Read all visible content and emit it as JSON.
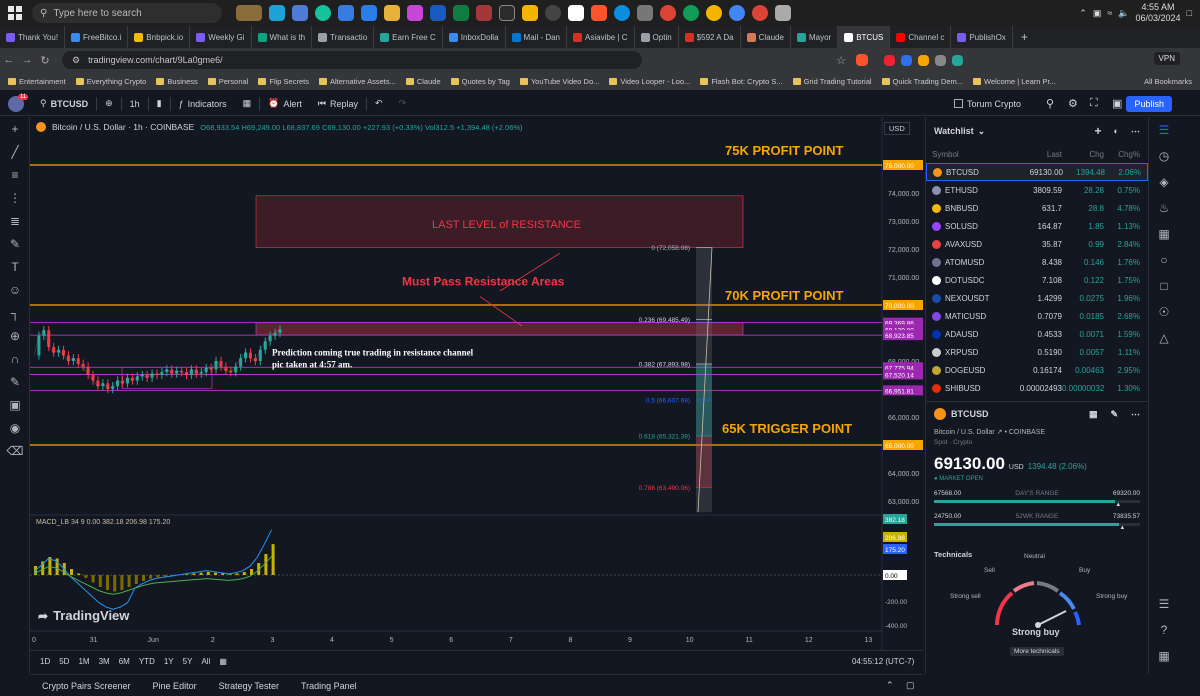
{
  "taskbar": {
    "search_placeholder": "Type here to search",
    "time": "4:55 AM",
    "date": "06/03/2024"
  },
  "tabs": [
    {
      "label": "Thank You!",
      "color": "#7a5cf0"
    },
    {
      "label": "FreeBitco.i",
      "color": "#3a8cf5"
    },
    {
      "label": "Bnbpick.io",
      "color": "#f0b90b"
    },
    {
      "label": "Weekly Gi",
      "color": "#7a5cf0"
    },
    {
      "label": "What is th",
      "color": "#10a37f"
    },
    {
      "label": "Transactio",
      "color": "#9aa0a6"
    },
    {
      "label": "Earn Free C",
      "color": "#26a69a"
    },
    {
      "label": "InboxDolla",
      "color": "#3a8cf5"
    },
    {
      "label": "Mail - Dan",
      "color": "#0078d4"
    },
    {
      "label": "Asiavibe | C",
      "color": "#d93025"
    },
    {
      "label": "Optin",
      "color": "#9aa0a6"
    },
    {
      "label": "$592 A Da",
      "color": "#d93025"
    },
    {
      "label": "Claude",
      "color": "#d97757"
    },
    {
      "label": "Mayor",
      "color": "#26a69a"
    },
    {
      "label": "BTCUS",
      "color": "#ffffff",
      "active": true
    },
    {
      "label": "Channel c",
      "color": "#ff0000"
    },
    {
      "label": "PublishOx",
      "color": "#7a5cf0"
    }
  ],
  "address": {
    "url": "tradingview.com/chart/9La0gme6/",
    "vpn": "VPN"
  },
  "bookmarks": [
    "Entertainment",
    "Everything Crypto",
    "Business",
    "Personal",
    "Flip Secrets",
    "Alternative Assets...",
    "Claude",
    "Quotes by Tag",
    "YouTube Video Do...",
    "Video Looper - Loo...",
    "Flash Bot: Crypto S...",
    "Grid Trading Tutorial",
    "Quick Trading Dem...",
    "Welcome | Learn Pr..."
  ],
  "bookmarks_all": "All Bookmarks",
  "toolbar": {
    "badge": "11",
    "symbol": "BTCUSD",
    "interval": "1h",
    "indicators": "Indicators",
    "alert": "Alert",
    "replay": "Replay",
    "layout_name": "Torum Crypto",
    "publish": "Publish"
  },
  "chart": {
    "title": "Bitcoin / U.S. Dollar · 1h · COINBASE",
    "ohlc": "O68,933.54 H69,249.00 L68,837.69 C69,130.00 +227.93 (+0.33%) Vol312.5 +1,394.48 (+2.06%)",
    "currency": "USD",
    "annotations": {
      "p75": "75K PROFIT POINT",
      "p70": "70K PROFIT POINT",
      "p65": "65K TRIGGER POINT",
      "resistance": "LAST LEVEL of RESISTANCE",
      "must_pass": "Must Pass Resistance Areas",
      "prediction_line1": "Prediction coming true trading in resistance channel",
      "prediction_line2": "pic taken at 4:57 am."
    },
    "fib_labels": [
      "0 (72,058.08)",
      "0.236 (69,485.49)",
      "0.382 (67,893.98)",
      "0.5 (66,607.69)",
      "0.618 (65,321.39)",
      "0.786 (63,490.06)"
    ],
    "macd_label": "MACD_LB 34 9  0.00  382.18  206.98  175.20",
    "macd_axis": [
      "382.18",
      "206.98",
      "175.20",
      "0.00",
      "-200.00",
      "-400.00"
    ],
    "time_labels": [
      "0",
      "31",
      "Jun",
      "2",
      "3",
      "4",
      "5",
      "6",
      "7",
      "8",
      "9",
      "10",
      "11",
      "12",
      "13"
    ],
    "logo": "TradingView"
  },
  "chart_data": {
    "type": "line",
    "title": "Bitcoin / U.S. Dollar · 1h · COINBASE",
    "ylim": [
      62500,
      76000
    ],
    "y_ticks": [
      63000,
      64000,
      65000,
      66000,
      67000,
      68000,
      69000,
      70000,
      71000,
      72000,
      73000,
      74000,
      75000
    ],
    "price_labels": [
      {
        "value": "75,000.00",
        "color": "#f7a600",
        "price": 75000
      },
      {
        "value": "70,000.00",
        "color": "#f7a600",
        "price": 70000
      },
      {
        "value": "69,369.86",
        "color": "#9c27b0",
        "price": 69370
      },
      {
        "value": "69,130.00",
        "color": "#9c27b0",
        "price": 69130
      },
      {
        "value": "68,923.85",
        "color": "#9c27b0",
        "price": 68924
      },
      {
        "value": "67,775.94",
        "color": "#9c27b0",
        "price": 67776
      },
      {
        "value": "67,520.14",
        "color": "#9c27b0",
        "price": 67520
      },
      {
        "value": "66,951.81",
        "color": "#9c27b0",
        "price": 66952
      },
      {
        "value": "65,000.00",
        "color": "#f7a600",
        "price": 65000
      }
    ],
    "horizontal_lines": [
      {
        "price": 75000,
        "color": "#f7a600"
      },
      {
        "price": 70000,
        "color": "#f7a600"
      },
      {
        "price": 65000,
        "color": "#f7a600"
      },
      {
        "price": 69370,
        "color": "#c542d9"
      },
      {
        "price": 68924,
        "color": "#c542d9"
      },
      {
        "price": 67776,
        "color": "#c542d9"
      },
      {
        "price": 67520,
        "color": "#c542d9"
      },
      {
        "price": 66952,
        "color": "#c542d9"
      }
    ],
    "price_series": [
      68200,
      68900,
      69100,
      68500,
      68300,
      68400,
      68200,
      68000,
      68100,
      67900,
      67800,
      67500,
      67300,
      67100,
      67200,
      67000,
      67100,
      67300,
      67200,
      67400,
      67300,
      67450,
      67500,
      67400,
      67550,
      67500,
      67600,
      67700,
      67550,
      67650,
      67600,
      67500,
      67700,
      67550,
      67600,
      67750,
      67700,
      68000,
      67800,
      67650,
      67600,
      67800,
      68100,
      68300,
      68100,
      68000,
      68400,
      68700,
      68900,
      69000,
      69130
    ],
    "macd_histogram": [
      60,
      90,
      120,
      110,
      80,
      40,
      10,
      -20,
      -50,
      -80,
      -100,
      -110,
      -100,
      -80,
      -60,
      -40,
      -25,
      -15,
      -10,
      -5,
      0,
      5,
      10,
      15,
      20,
      15,
      10,
      5,
      10,
      20,
      40,
      80,
      140,
      206
    ]
  },
  "timebar": {
    "ranges": [
      "1D",
      "5D",
      "1M",
      "3M",
      "6M",
      "YTD",
      "1Y",
      "5Y",
      "All"
    ],
    "clock": "04:55:12 (UTC-7)"
  },
  "bottom_tabs": [
    "Crypto Pairs Screener",
    "Pine Editor",
    "Strategy Tester",
    "Trading Panel"
  ],
  "watchlist": {
    "title": "Watchlist",
    "headers": {
      "symbol": "Symbol",
      "last": "Last",
      "chg": "Chg",
      "chgp": "Chg%"
    },
    "rows": [
      {
        "symbol": "BTCUSD",
        "last": "69130.00",
        "chg": "1394.48",
        "chgp": "2.06%",
        "color": "#f7931a"
      },
      {
        "symbol": "ETHUSD",
        "last": "3809.59",
        "chg": "28.28",
        "chgp": "0.75%",
        "color": "#8a92b2"
      },
      {
        "symbol": "BNBUSD",
        "last": "631.7",
        "chg": "28.8",
        "chgp": "4.78%",
        "color": "#f0b90b"
      },
      {
        "symbol": "SOLUSD",
        "last": "164.87",
        "chg": "1.85",
        "chgp": "1.13%",
        "color": "#9945ff"
      },
      {
        "symbol": "AVAXUSD",
        "last": "35.87",
        "chg": "0.99",
        "chgp": "2.84%",
        "color": "#e84142"
      },
      {
        "symbol": "ATOMUSD",
        "last": "8.438",
        "chg": "0.146",
        "chgp": "1.76%",
        "color": "#6f7390"
      },
      {
        "symbol": "DOTUSDC",
        "last": "7.108",
        "chg": "0.122",
        "chgp": "1.75%",
        "color": "#ffffff"
      },
      {
        "symbol": "NEXOUSDT",
        "last": "1.4299",
        "chg": "0.0275",
        "chgp": "1.96%",
        "color": "#1a4dab"
      },
      {
        "symbol": "MATICUSD",
        "last": "0.7079",
        "chg": "0.0185",
        "chgp": "2.68%",
        "color": "#8247e5"
      },
      {
        "symbol": "ADAUSD",
        "last": "0.4533",
        "chg": "0.0071",
        "chgp": "1.59%",
        "color": "#0033ad"
      },
      {
        "symbol": "XRPUSD",
        "last": "0.5190",
        "chg": "0.0057",
        "chgp": "1.11%",
        "color": "#cccccc"
      },
      {
        "symbol": "DOGEUSD",
        "last": "0.16174",
        "chg": "0.00463",
        "chgp": "2.95%",
        "color": "#c2a633"
      },
      {
        "symbol": "SHIBUSD",
        "last": "0.00002493",
        "chg": "0.00000032",
        "chgp": "1.30%",
        "color": "#e42d04"
      }
    ]
  },
  "detail": {
    "symbol": "BTCUSD",
    "name": "Bitcoin / U.S. Dollar",
    "exchange": "COINBASE",
    "type": "Spot · Crypto",
    "price": "69130.00",
    "currency": "USD",
    "change": "1394.48 (2.06%)",
    "market_status": "MARKET OPEN",
    "day_low": "67568.00",
    "day_label": "DAY'S RANGE",
    "day_high": "69320.00",
    "week_low": "24750.00",
    "week_label": "52WK RANGE",
    "week_high": "73835.57",
    "technicals": "Technicals",
    "gauge_neutral": "Neutral",
    "gauge_sell": "Sell",
    "gauge_buy": "Buy",
    "gauge_strong_sell": "Strong sell",
    "gauge_strong_buy": "Strong buy",
    "rating": "Strong buy",
    "more": "More technicals"
  }
}
